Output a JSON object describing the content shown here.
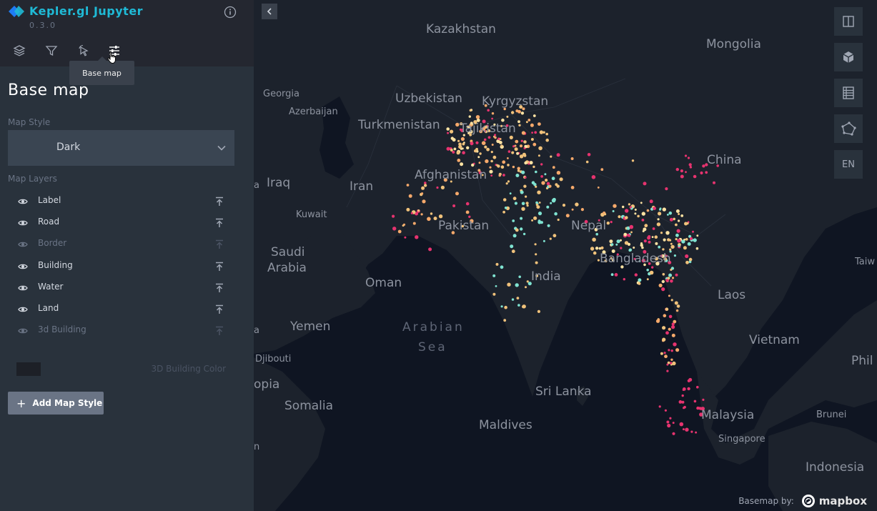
{
  "app": {
    "title": "Kepler.gl Jupyter",
    "version": "0.3.0"
  },
  "panel_tabs": [
    {
      "name": "layers"
    },
    {
      "name": "filters"
    },
    {
      "name": "interactions"
    },
    {
      "name": "base-map"
    }
  ],
  "tooltip": "Base map",
  "panel": {
    "title": "Base map",
    "map_style_label": "Map Style",
    "map_style_value": "Dark",
    "map_layers_label": "Map Layers",
    "layers": [
      {
        "label": "Label",
        "visible": true
      },
      {
        "label": "Road",
        "visible": true
      },
      {
        "label": "Border",
        "visible": false
      },
      {
        "label": "Building",
        "visible": true
      },
      {
        "label": "Water",
        "visible": true
      },
      {
        "label": "Land",
        "visible": true
      },
      {
        "label": "3d Building",
        "visible": false
      }
    ],
    "building_color_label": "3D Building Color",
    "building_color": "#1D2027",
    "add_map_style": "Add Map Style"
  },
  "map": {
    "controls": [
      "split-map",
      "3d-view",
      "legend",
      "draw",
      "EN"
    ],
    "attribution_text": "Basemap by:",
    "attribution_brand": "mapbox",
    "labels": [
      "Kazakhstan",
      "Mongolia",
      "Uzbekistan",
      "Kyrgyzstan",
      "Georgia",
      "Azerbaijan",
      "Turkmenistan",
      "Tajikistan",
      "China",
      "Afghanistan",
      "Iraq",
      "Iran",
      "Kuwait",
      "Pakistan",
      "Nepal",
      "Saudi",
      "Arabia",
      "Bangladesh",
      "Taiw",
      "Oman",
      "India",
      "Laos",
      "Yemen",
      "Arabian",
      "Sea",
      "Vietnam",
      "Phil",
      "Djibouti",
      "opia",
      "Sri Lanka",
      "Malaysia",
      "Brunei",
      "Somalia",
      "Maldives",
      "Singapore",
      "Indonesia",
      "a",
      "a",
      "n"
    ]
  },
  "colors": {
    "accent": "#1FBAD6",
    "panel": "#29323C",
    "header": "#242730",
    "map_bg": "#0f1522",
    "land": "#1c222c"
  }
}
